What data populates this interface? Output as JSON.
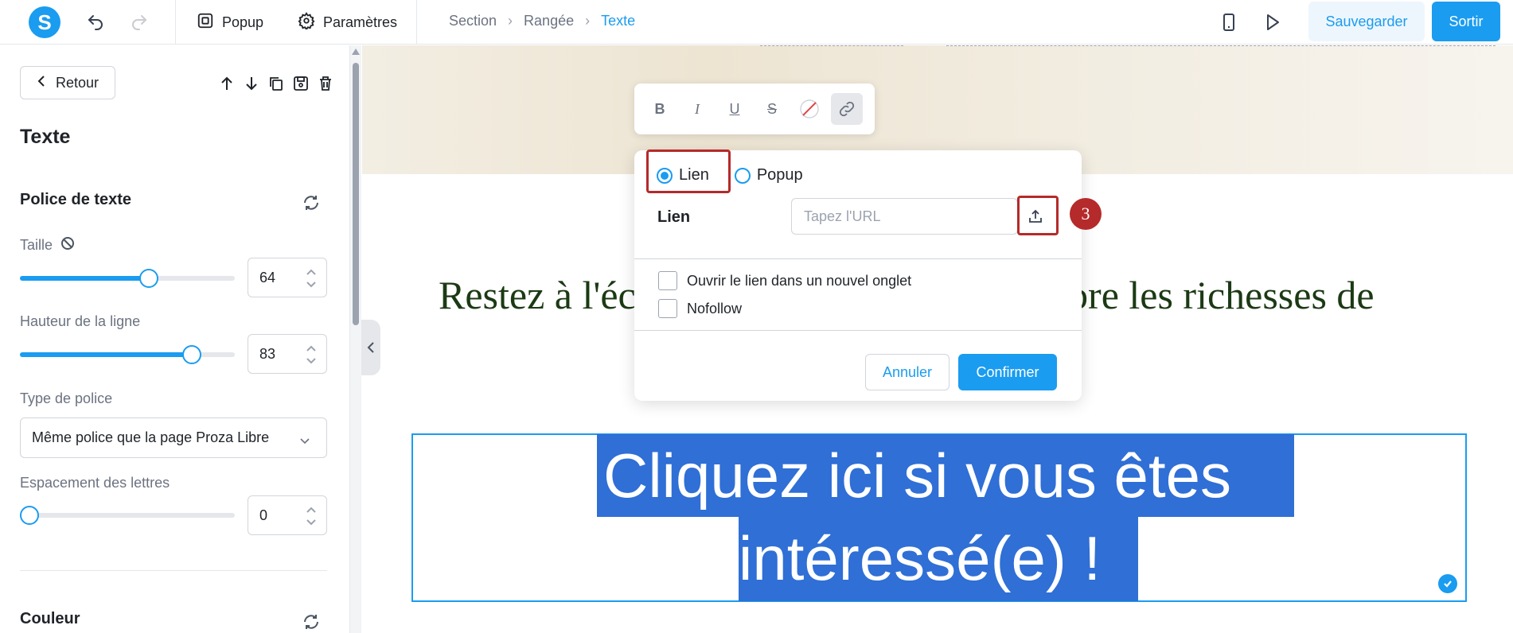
{
  "topbar": {
    "logo": "S",
    "popup_label": "Popup",
    "settings_label": "Paramètres",
    "breadcrumb": [
      "Section",
      "Rangée",
      "Texte"
    ],
    "save_label": "Sauvegarder",
    "exit_label": "Sortir",
    "accent": "#1a9cf0"
  },
  "sidebar": {
    "back_label": "Retour",
    "panel_title": "Texte",
    "font_section": "Police de texte",
    "size_label": "Taille",
    "size_value": "64",
    "size_slider_fraction": 0.6,
    "line_height_label": "Hauteur de la ligne",
    "line_height_value": "83",
    "line_height_slider_fraction": 0.8,
    "font_type_label": "Type de police",
    "font_type_value": "Même police que la page Proza Libre",
    "letter_spacing_label": "Espacement des lettres",
    "letter_spacing_value": "0",
    "letter_spacing_slider_fraction": 0.0,
    "color_section": "Couleur"
  },
  "canvas": {
    "serif_left": "Restez à l'éc",
    "serif_right": "élèbre les richesses de",
    "selected_line1": "Cliquez ici si vous êtes",
    "selected_line2": "intéressé(e) !"
  },
  "link_dialog": {
    "radio_link": "Lien",
    "radio_popup": "Popup",
    "link_label": "Lien",
    "url_placeholder": "Tapez l'URL",
    "step_number": "3",
    "new_tab_label": "Ouvrir le lien dans un nouvel onglet",
    "nofollow_label": "Nofollow",
    "cancel_label": "Annuler",
    "confirm_label": "Confirmer"
  }
}
